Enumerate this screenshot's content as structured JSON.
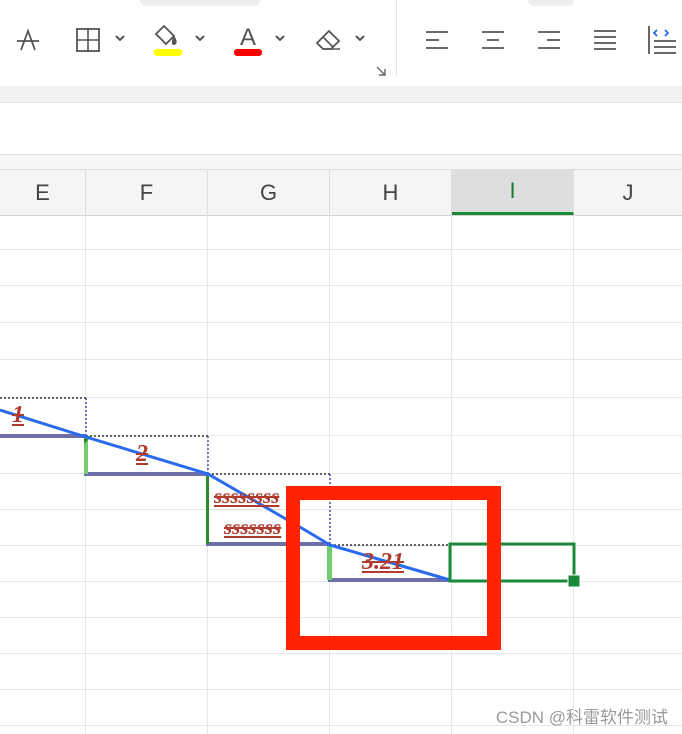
{
  "toolbar": {
    "icons": [
      "strikethrough-icon",
      "borders-icon",
      "fill-color-icon",
      "font-color-icon",
      "clear-format-icon",
      "align-left-icon",
      "align-center-icon",
      "align-right-icon",
      "justify-icon",
      "distributed-icon"
    ],
    "fill_color": "#ffff00",
    "font_color": "#ff0000",
    "font_color_letter": "A"
  },
  "columns": [
    "E",
    "F",
    "G",
    "H",
    "I",
    "J"
  ],
  "selected_column": "I",
  "cells": {
    "e_value": "1",
    "f_value": "2",
    "g_value_line1": "ssssssss",
    "g_value_line2": "sssssss",
    "h_value": "3.21"
  },
  "colors": {
    "selection_green": "#188a3a",
    "cell_text": "#b03a2e",
    "highlight_red": "#ff2200",
    "connector_blue": "#2a6af0",
    "underline_purple": "#6e6ea8"
  },
  "watermark": "CSDN @科雷软件测试"
}
